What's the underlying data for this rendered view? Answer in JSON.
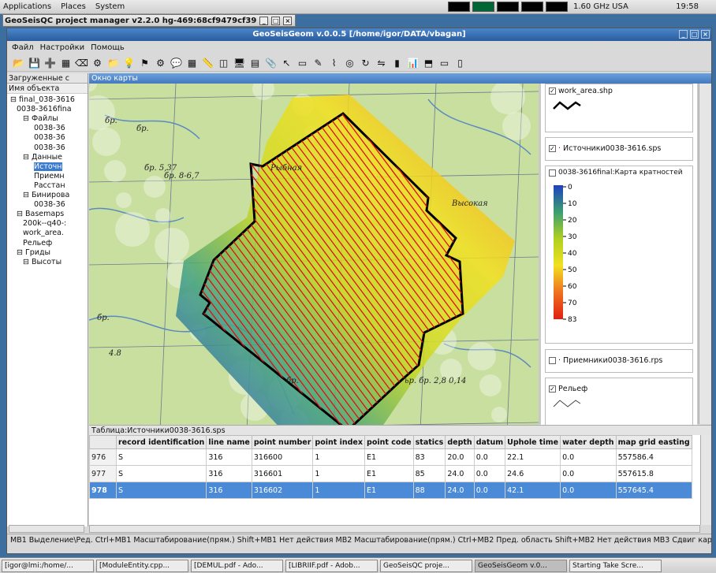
{
  "gnome": {
    "menus": [
      "Applications",
      "Places",
      "System"
    ],
    "cpu": "1.60 GHz USA",
    "clock": "19:58"
  },
  "pm_title": "GeoSeisQC project manager v2.2.0 hg-469:68cf9479cf39",
  "window": {
    "title": "GeoSeisGeom v.0.0.5 [/home/igor/DATA/vbagan]"
  },
  "menubar": [
    "Файл",
    "Настройки",
    "Помощь"
  ],
  "toolbar_icons": [
    "open-folder-icon",
    "save-icon",
    "add-layer-icon",
    "raster-icon",
    "eraser-icon",
    "gear-icon",
    "folder-icon",
    "bulb-icon",
    "flag-icon",
    "settings-icon",
    "bubble-icon",
    "grid-icon",
    "ruler-icon",
    "layer-icon",
    "monitor-icon",
    "table-icon",
    "clip-icon",
    "pointer-icon",
    "rect-select-icon",
    "pencil-icon",
    "polyline-icon",
    "target-icon",
    "refresh-icon",
    "flip-icon",
    "histogram-icon",
    "bars-icon",
    "split-horizontal-icon",
    "window-icon",
    "panel-icon"
  ],
  "left": {
    "header": "Загруженные с",
    "col": "Имя объекта",
    "tree": [
      "final_038-3616",
      "0038-3616fina",
      "Файлы",
      "0038-36",
      "0038-36",
      "0038-36",
      "Данные",
      "Источн",
      "Приемн",
      "Расстан",
      "Бинирова",
      "0038-36",
      "Basemaps",
      "200k--q40-:",
      "work_area.",
      "Рельеф",
      "Гриды",
      "Высоты"
    ]
  },
  "map": {
    "title": "Окно карты",
    "labels": [
      "бр.",
      "бр.",
      "бр. 8-6,7",
      "бр. 5,37",
      "Рыбная",
      "Высокая",
      "4.8",
      "ьр. бр. 2,8 0,14",
      "бр.",
      "бр."
    ]
  },
  "layers": [
    {
      "name": "work_area.shp",
      "checked": true
    },
    {
      "name": "Источники0038-3616.sps",
      "checked": true
    },
    {
      "name": "0038-3616final:Карта кратностей",
      "checked": false
    },
    {
      "name": "Приемники0038-3616.rps",
      "checked": false
    },
    {
      "name": "Рельеф",
      "checked": true
    }
  ],
  "legend": {
    "ticks": [
      "0",
      "10",
      "20",
      "30",
      "40",
      "50",
      "60",
      "70",
      "83"
    ],
    "colors": [
      "#2040c0",
      "#3aa070",
      "#b0d020",
      "#f0e020",
      "#f07020",
      "#e02010"
    ]
  },
  "table": {
    "title": "Таблица:Источники0038-3616.sps",
    "columns": [
      "record identification",
      "line name",
      "point number",
      "point index",
      "point code",
      "statics",
      "depth",
      "datum",
      "Uphole time",
      "water depth",
      "map grid easting"
    ],
    "rows": [
      {
        "n": "976",
        "c": [
          "S",
          "316",
          "316600",
          "1",
          "E1",
          "83",
          "20.0",
          "0.0",
          "22.1",
          "0.0",
          "557586.4"
        ]
      },
      {
        "n": "977",
        "c": [
          "S",
          "316",
          "316601",
          "1",
          "E1",
          "85",
          "24.0",
          "0.0",
          "24.6",
          "0.0",
          "557615.8"
        ]
      },
      {
        "n": "978",
        "c": [
          "S",
          "316",
          "316602",
          "1",
          "E1",
          "88",
          "24.0",
          "0.0",
          "42.1",
          "0.0",
          "557645.4"
        ],
        "selected": true
      }
    ]
  },
  "status": "MB1 Выделение\\Ред. Ctrl+MB1 Масштабирование(прям.) Shift+MB1 Нет действия MB2 Масштабирование(прям.) Ctrl+MB2 Пред. область Shift+MB2 Нет действия MB3 Сдвиг карты С",
  "taskbar": [
    "[igor@lmi:/home/...",
    "[ModuleEntity.cpp...",
    "[DEMUL.pdf - Ado...",
    "[LIBRIIF.pdf - Adob...",
    "GeoSeisQC proje...",
    "GeoSeisGeom v.0...",
    "Starting Take Scre..."
  ]
}
